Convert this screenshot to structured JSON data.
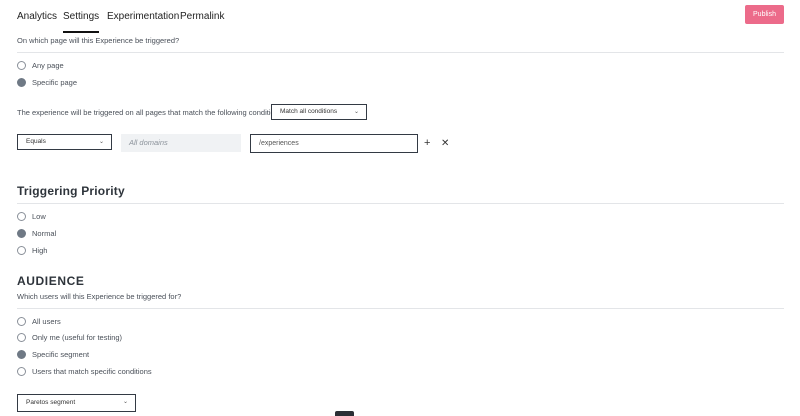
{
  "tabs": [
    "Analytics",
    "Settings",
    "Experimentation",
    "Permalink"
  ],
  "publish_label": "Publish",
  "trigger": {
    "question": "On which page will this Experience be triggered?",
    "options": [
      "Any page",
      "Specific page"
    ],
    "selected": "Specific page",
    "conditions_text": "The experience will be triggered on all pages that match the following conditions?",
    "match_value": "Match all conditions",
    "rule": {
      "operator": "Equals",
      "domain_placeholder": "All domains",
      "path_value": "/experiences"
    }
  },
  "priority": {
    "title": "Triggering Priority",
    "options": [
      "Low",
      "Normal",
      "High"
    ],
    "selected": "Normal"
  },
  "audience": {
    "title": "AUDIENCE",
    "question": "Which users will this Experience be triggered for?",
    "options": [
      "All users",
      "Only me (useful for testing)",
      "Specific segment",
      "Users that match specific conditions"
    ],
    "selected": "Specific segment",
    "segment_value": "Paretos segment"
  },
  "icons": {
    "add": "plus-icon",
    "remove": "close-icon",
    "dropdown": "chevron-down-icon",
    "scroll": "chevron-down-icon"
  },
  "colors": {
    "publish": "#ec6b8a",
    "radio_selected": "#6f7985"
  }
}
